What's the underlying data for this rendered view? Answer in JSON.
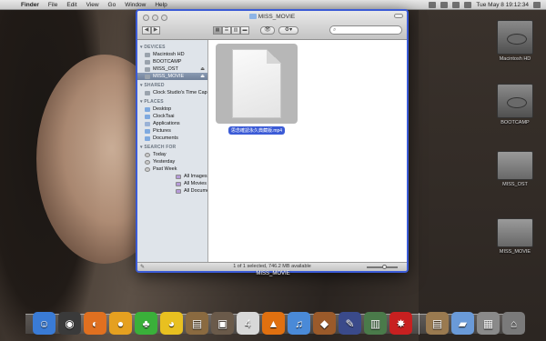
{
  "menubar": {
    "apple": "",
    "items": [
      "Finder",
      "File",
      "Edit",
      "View",
      "Go",
      "Window",
      "Help"
    ],
    "clock": "Tue May 8  19:12:34"
  },
  "window": {
    "title": "MISS_MOVIE",
    "nav_back": "◀",
    "nav_forward": "▶",
    "quick_look": "👁",
    "action": "⚙▾",
    "search_placeholder": "",
    "sidebar": {
      "devices_header": "DEVICES",
      "devices": [
        "Macintosh HD",
        "BOOTCAMP",
        "MISS_OST",
        "MISS_MOVIE"
      ],
      "shared_header": "SHARED",
      "shared": [
        "Clock Studio's Time Capsule"
      ],
      "places_header": "PLACES",
      "places": [
        "Desktop",
        "ClockTsai",
        "Applications",
        "Pictures",
        "Documents"
      ],
      "search_header": "SEARCH FOR",
      "search": [
        "Today",
        "Yesterday",
        "Past Week",
        "All Images",
        "All Movies",
        "All Documents"
      ]
    },
    "file": {
      "name": "思念確認永久典藏版.mp4"
    },
    "status": "1 of 1 selected, 746.2 MB available"
  },
  "caption": "MISS_MOVIE",
  "desktop_drives": [
    "Macintosh HD",
    "BOOTCAMP",
    "MISS_OST",
    "MISS_MOVIE"
  ],
  "dock": {
    "items": [
      {
        "name": "finder",
        "glyph": "☺",
        "color": "#3a7bd5"
      },
      {
        "name": "dashboard",
        "glyph": "◉",
        "color": "#3a3a3a"
      },
      {
        "name": "firefox",
        "glyph": "◐",
        "color": "#e07020"
      },
      {
        "name": "ball",
        "glyph": "●",
        "color": "#e5a020"
      },
      {
        "name": "android",
        "glyph": "♣",
        "color": "#3ab03a"
      },
      {
        "name": "duck",
        "glyph": "◕",
        "color": "#e8c020"
      },
      {
        "name": "book",
        "glyph": "▤",
        "color": "#8a6a40"
      },
      {
        "name": "photos",
        "glyph": "▣",
        "color": "#6a5a4a"
      },
      {
        "name": "ical",
        "glyph": "4",
        "color": "#d8d8d8"
      },
      {
        "name": "vlc",
        "glyph": "▲",
        "color": "#e07010"
      },
      {
        "name": "itunes",
        "glyph": "♫",
        "color": "#4a8ad8"
      },
      {
        "name": "keynote",
        "glyph": "◆",
        "color": "#9a5a2a"
      },
      {
        "name": "script",
        "glyph": "✎",
        "color": "#3a4a8a"
      },
      {
        "name": "stocks",
        "glyph": "▥",
        "color": "#4a7a4a"
      },
      {
        "name": "star",
        "glyph": "✸",
        "color": "#c82020"
      }
    ],
    "stacks": [
      {
        "name": "notes",
        "glyph": "▤",
        "color": "#9a7a50"
      },
      {
        "name": "folder",
        "glyph": "▰",
        "color": "#6a9ad8"
      },
      {
        "name": "documents",
        "glyph": "▦",
        "color": "#8a8a8a"
      },
      {
        "name": "trash",
        "glyph": "⌂",
        "color": "#7a7a7a"
      }
    ]
  }
}
